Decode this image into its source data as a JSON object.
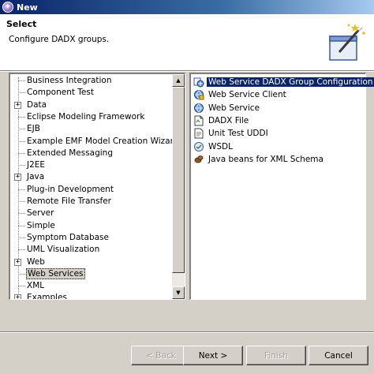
{
  "window": {
    "title": "New",
    "icon": "new-wizard-icon"
  },
  "banner": {
    "heading": "Select",
    "description": "Configure DADX groups.",
    "icon": "magic-wand-icon"
  },
  "tree": {
    "items": [
      {
        "label": "Business Integration",
        "expandable": false,
        "selected": false
      },
      {
        "label": "Component Test",
        "expandable": false,
        "selected": false
      },
      {
        "label": "Data",
        "expandable": true,
        "selected": false
      },
      {
        "label": "Eclipse Modeling Framework",
        "expandable": false,
        "selected": false
      },
      {
        "label": "EJB",
        "expandable": false,
        "selected": false
      },
      {
        "label": "Example EMF Model Creation Wizards",
        "expandable": false,
        "selected": false
      },
      {
        "label": "Extended Messaging",
        "expandable": false,
        "selected": false
      },
      {
        "label": "J2EE",
        "expandable": false,
        "selected": false
      },
      {
        "label": "Java",
        "expandable": true,
        "selected": false
      },
      {
        "label": "Plug-in Development",
        "expandable": false,
        "selected": false
      },
      {
        "label": "Remote File Transfer",
        "expandable": false,
        "selected": false
      },
      {
        "label": "Server",
        "expandable": false,
        "selected": false
      },
      {
        "label": "Simple",
        "expandable": false,
        "selected": false
      },
      {
        "label": "Symptom Database",
        "expandable": false,
        "selected": false
      },
      {
        "label": "UML Visualization",
        "expandable": false,
        "selected": false
      },
      {
        "label": "Web",
        "expandable": true,
        "selected": false
      },
      {
        "label": "Web Services",
        "expandable": false,
        "selected": true
      },
      {
        "label": "XML",
        "expandable": false,
        "selected": false
      },
      {
        "label": "Examples",
        "expandable": true,
        "selected": false
      }
    ],
    "expander_glyph": "+"
  },
  "wizards": {
    "items": [
      {
        "label": "Web Service DADX Group Configuration",
        "icon": "dadx-group-icon",
        "selected": true
      },
      {
        "label": "Web Service Client",
        "icon": "web-service-client-icon",
        "selected": false
      },
      {
        "label": "Web Service",
        "icon": "web-service-icon",
        "selected": false
      },
      {
        "label": "DADX File",
        "icon": "dadx-file-icon",
        "selected": false
      },
      {
        "label": "Unit Test UDDI",
        "icon": "uddi-icon",
        "selected": false
      },
      {
        "label": "WSDL",
        "icon": "wsdl-icon",
        "selected": false
      },
      {
        "label": "Java beans for XML Schema",
        "icon": "java-bean-icon",
        "selected": false
      }
    ]
  },
  "buttons": {
    "back": "< Back",
    "next": "Next >",
    "finish": "Finish",
    "cancel": "Cancel"
  },
  "colors": {
    "selection": "#0a246a",
    "dialog_bg": "#d4d0c8"
  }
}
